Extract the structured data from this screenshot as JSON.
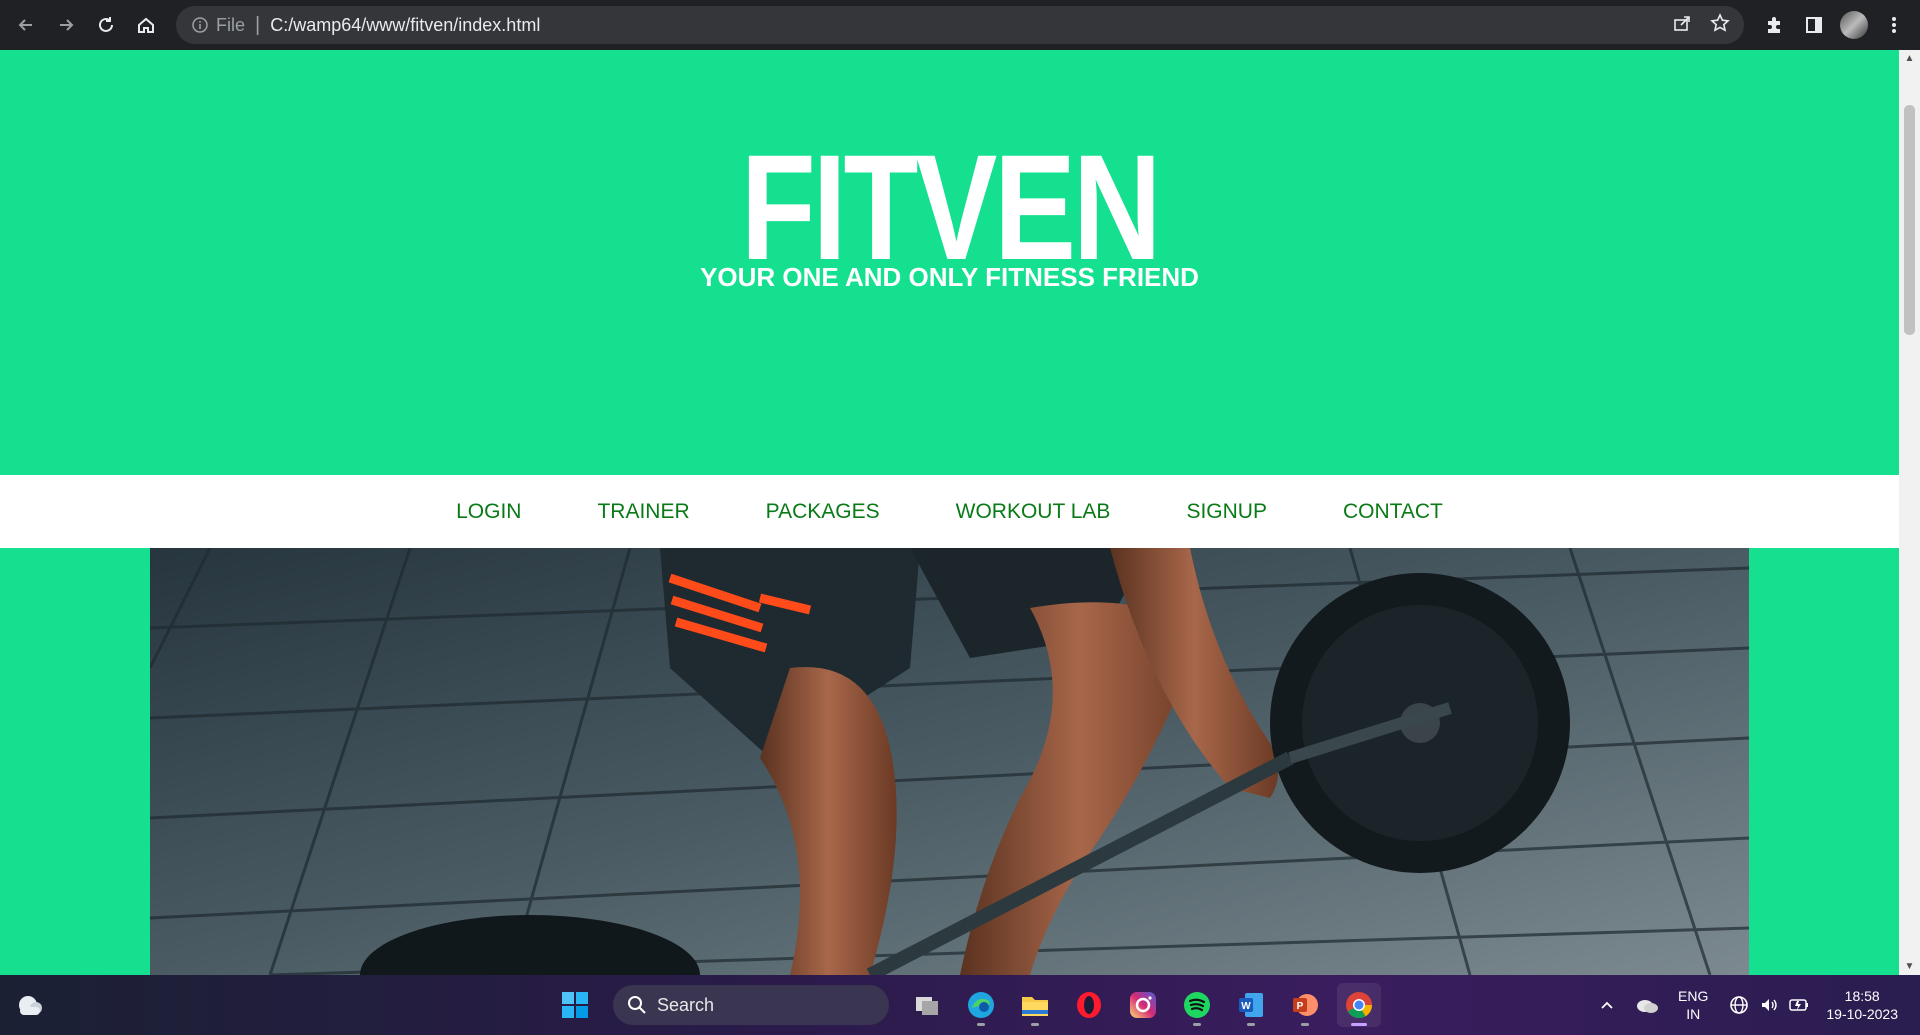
{
  "browser": {
    "back_icon": "arrow-left-icon",
    "forward_icon": "arrow-right-icon",
    "reload_icon": "reload-icon",
    "home_icon": "home-icon",
    "scheme_label": "File",
    "url": "C:/wamp64/www/fitven/index.html"
  },
  "site": {
    "logo": "FITVEN",
    "tagline": "YOUR ONE AND ONLY FITNESS FRIEND",
    "nav": [
      "LOGIN",
      "TRAINER",
      "PACKAGES",
      "WORKOUT LAB",
      "SIGNUP",
      "CONTACT"
    ],
    "colors": {
      "primary": "#14e090",
      "nav_text": "#0a7a17",
      "header_text": "#ffffff"
    }
  },
  "taskbar": {
    "search_placeholder": "Search",
    "lang_line1": "ENG",
    "lang_line2": "IN",
    "time": "18:58",
    "date": "19-10-2023"
  }
}
